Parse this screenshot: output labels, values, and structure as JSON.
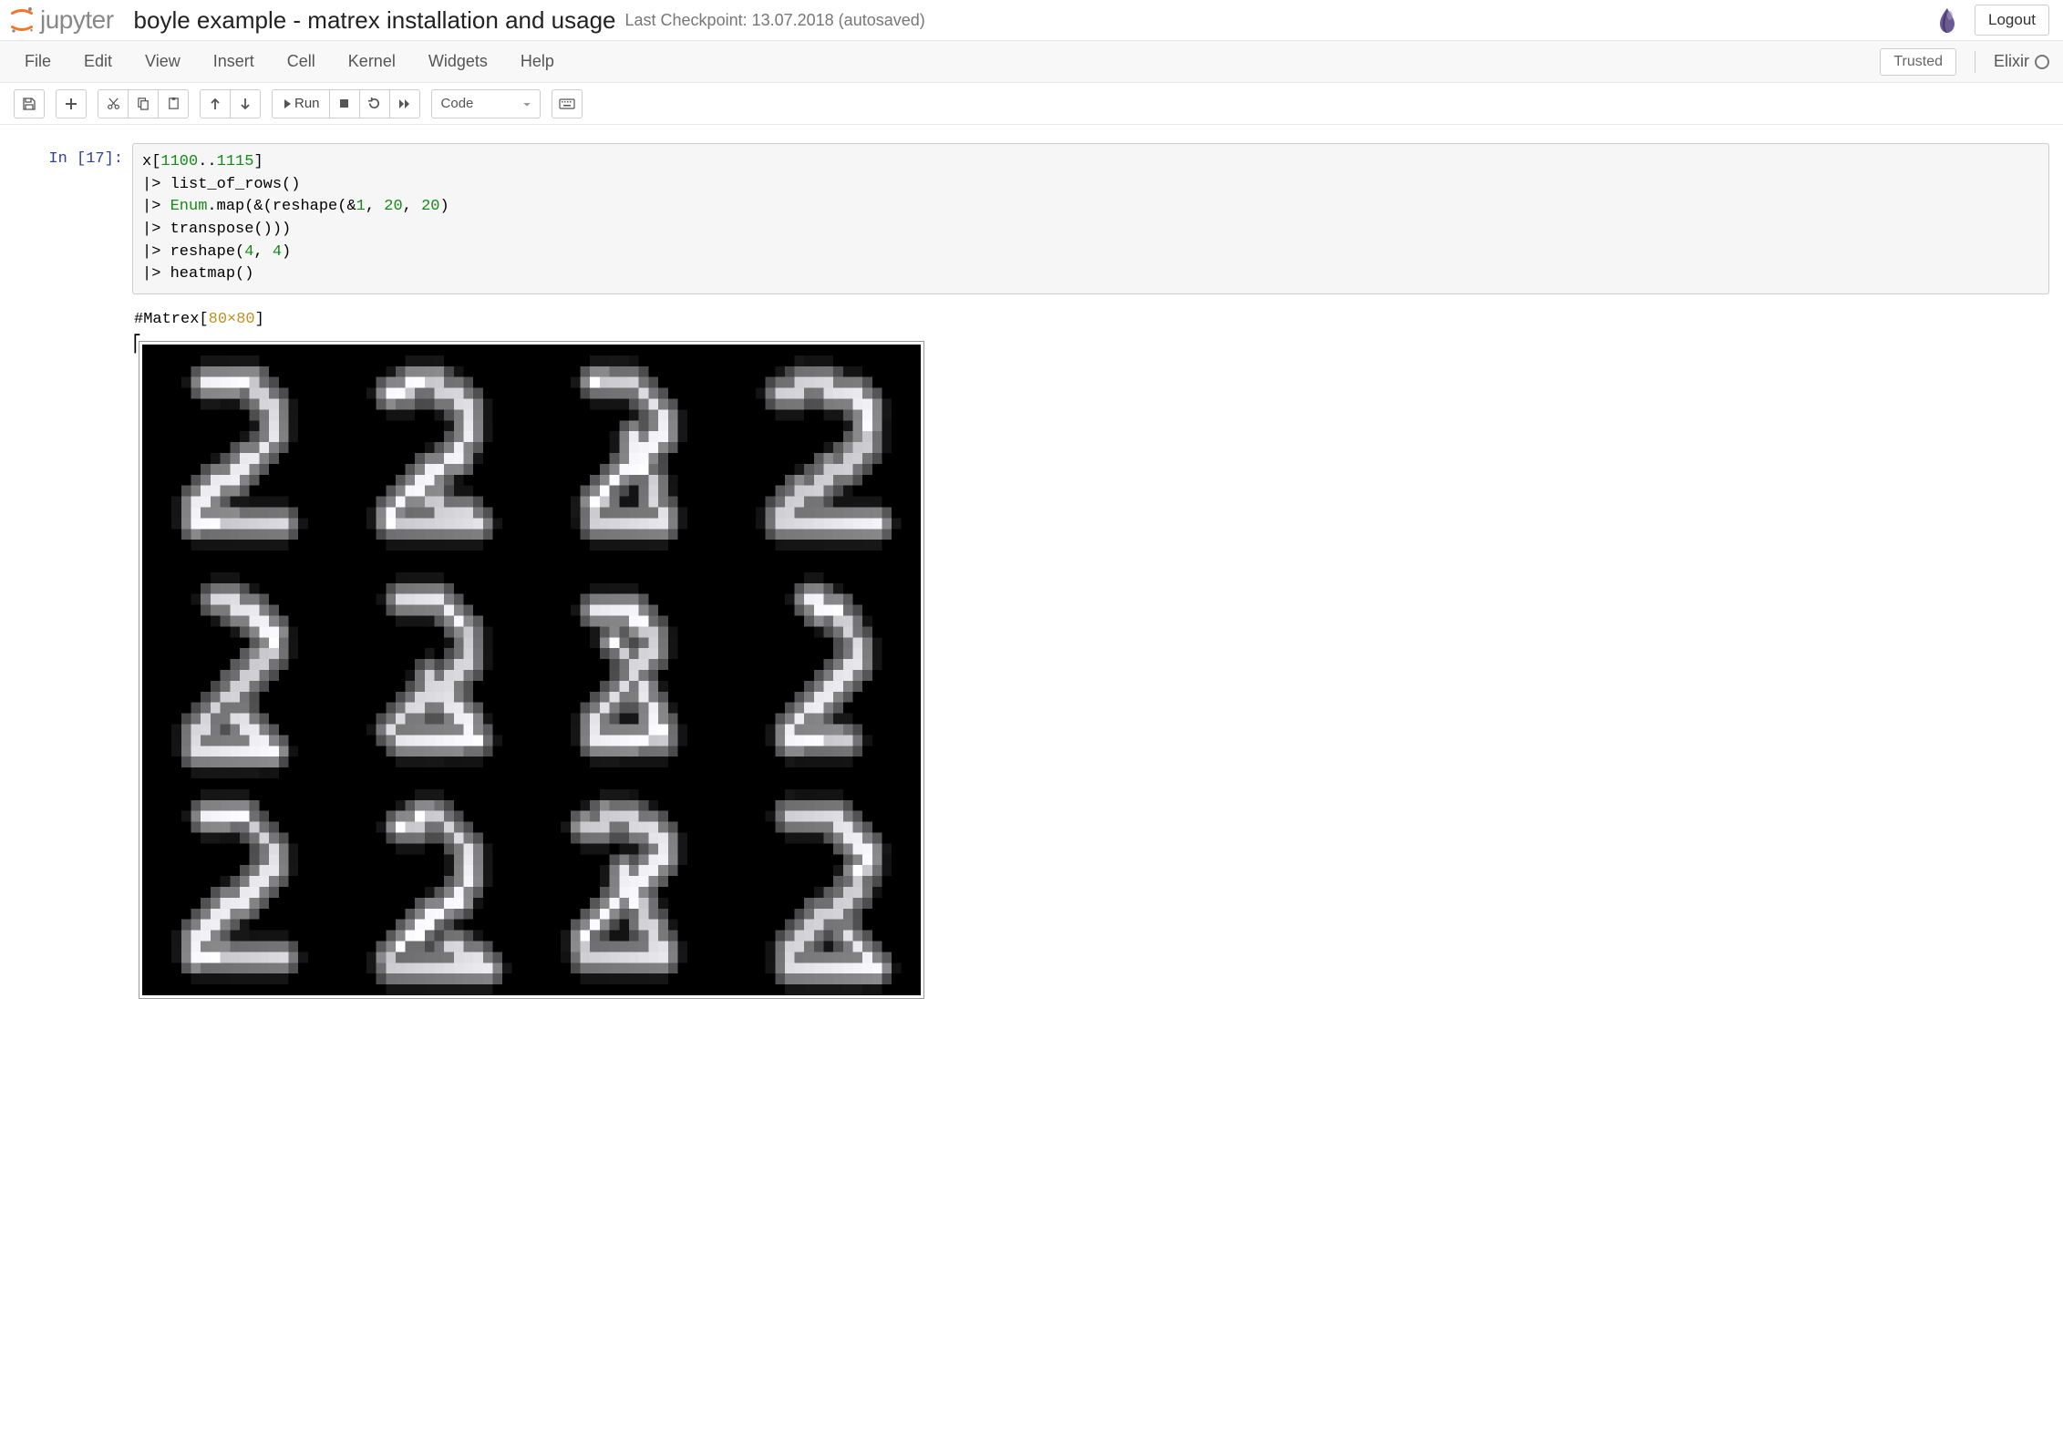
{
  "header": {
    "logo_text": "jupyter",
    "notebook_name": "boyle example - matrex installation and usage",
    "checkpoint": "Last Checkpoint: 13.07.2018  (autosaved)",
    "logout_label": "Logout"
  },
  "menubar": {
    "items": [
      "File",
      "Edit",
      "View",
      "Insert",
      "Cell",
      "Kernel",
      "Widgets",
      "Help"
    ],
    "trusted_label": "Trusted",
    "kernel_name": "Elixir"
  },
  "toolbar": {
    "run_label": "Run",
    "cell_type_value": "Code"
  },
  "cell": {
    "prompt_prefix": "In [",
    "prompt_num": "17",
    "prompt_suffix": "]:",
    "code": {
      "line1_a": "x[",
      "line1_b": "1100",
      "line1_c": "..",
      "line1_d": "1115",
      "line1_e": "]",
      "line2": "|> list_of_rows()",
      "line3_a": "|> ",
      "line3_b": "Enum",
      "line3_c": ".map(&(reshape(&",
      "line3_d": "1",
      "line3_e": ", ",
      "line3_f": "20",
      "line3_g": ", ",
      "line3_h": "20",
      "line3_i": ")",
      "line4": "|> transpose()))",
      "line5_a": "|> reshape(",
      "line5_b": "4",
      "line5_c": ", ",
      "line5_d": "4",
      "line5_e": ")",
      "line6": "|> heatmap()"
    }
  },
  "output": {
    "matrex_prefix": "#Matrex[",
    "matrex_dim": "80×80",
    "matrex_suffix": "]",
    "grid_rows": 3,
    "grid_cols": 4
  },
  "colors": {
    "accent": "#f37626",
    "menubar_bg": "#f8f8f8",
    "border": "#e7e7e7",
    "prompt_in": "#2c3e9e",
    "token_num": "#178a17",
    "matrex_dim": "#c09020"
  }
}
